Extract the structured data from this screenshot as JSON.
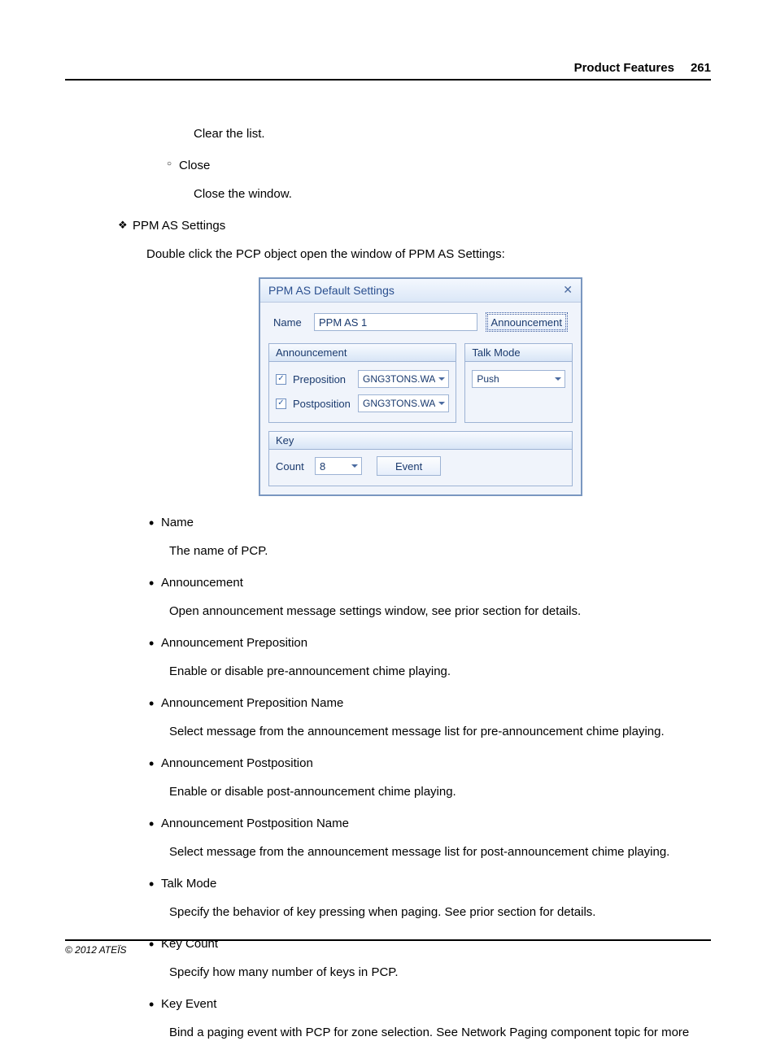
{
  "header": {
    "title": "Product Features",
    "page": "261"
  },
  "body": {
    "clear_list": "Clear the list.",
    "close_label": "Close",
    "close_desc": "Close the window.",
    "section_title": "PPM AS Settings",
    "section_intro": "Double click the PCP object open the window of PPM AS Settings:"
  },
  "dialog": {
    "title": "PPM AS Default Settings",
    "name_label": "Name",
    "name_value": "PPM AS 1",
    "ann_button": "Announcement",
    "ann_panel": {
      "title": "Announcement",
      "preposition_label": "Preposition",
      "preposition_value": "GNG3TONS.WA",
      "postposition_label": "Postposition",
      "postposition_value": "GNG3TONS.WA"
    },
    "talk_panel": {
      "title": "Talk Mode",
      "talk_value": "Push"
    },
    "key_panel": {
      "title": "Key",
      "count_label": "Count",
      "count_value": "8",
      "event_button": "Event"
    }
  },
  "items": {
    "name": {
      "t": "Name",
      "d": "The name of PCP."
    },
    "ann": {
      "t": "Announcement",
      "d": "Open announcement message settings window, see prior section for details."
    },
    "annprep": {
      "t": "Announcement Preposition",
      "d": "Enable or disable pre-announcement chime playing."
    },
    "annprepname": {
      "t": "Announcement Preposition Name",
      "d": "Select message from the announcement message list for pre-announcement chime playing."
    },
    "annpost": {
      "t": "Announcement Postposition",
      "d": "Enable or disable post-announcement chime playing."
    },
    "annpostname": {
      "t": "Announcement Postposition Name",
      "d": "Select message from the announcement message list for post-announcement chime playing."
    },
    "talkmode": {
      "t": "Talk Mode",
      "d": "Specify the behavior of key pressing when paging. See prior section for details."
    },
    "keycount": {
      "t": "Key Count",
      "d": "Specify how many number of keys in PCP."
    },
    "keyevent": {
      "t": "Key Event",
      "d": "Bind a paging event with PCP for zone selection. See Network Paging component topic for more"
    }
  },
  "footer": "© 2012 ATEÏS"
}
